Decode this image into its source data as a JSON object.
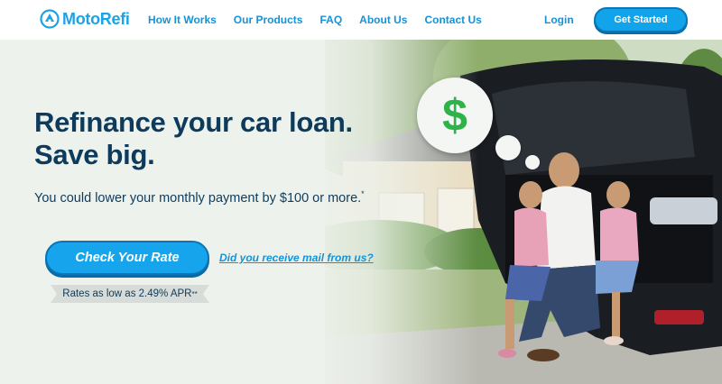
{
  "header": {
    "logo_text": "MotoRefi",
    "nav": [
      "How It Works",
      "Our Products",
      "FAQ",
      "About Us",
      "Contact Us"
    ],
    "login_label": "Login",
    "cta_label": "Get Started"
  },
  "hero": {
    "headline_line1": "Refinance your car loan.",
    "headline_line2": "Save big.",
    "subhead": "You could lower your monthly payment by $100 or more.",
    "subhead_mark": "*",
    "check_rate_label": "Check Your Rate",
    "mail_link": "Did you receive mail from us?",
    "rate_text": "Rates as low as 2.49% APR",
    "rate_mark": "**",
    "bubble_symbol": "$"
  },
  "colors": {
    "brand_blue": "#12a4ea",
    "navy": "#0e3b5c",
    "dollar_green": "#2eb34a"
  }
}
